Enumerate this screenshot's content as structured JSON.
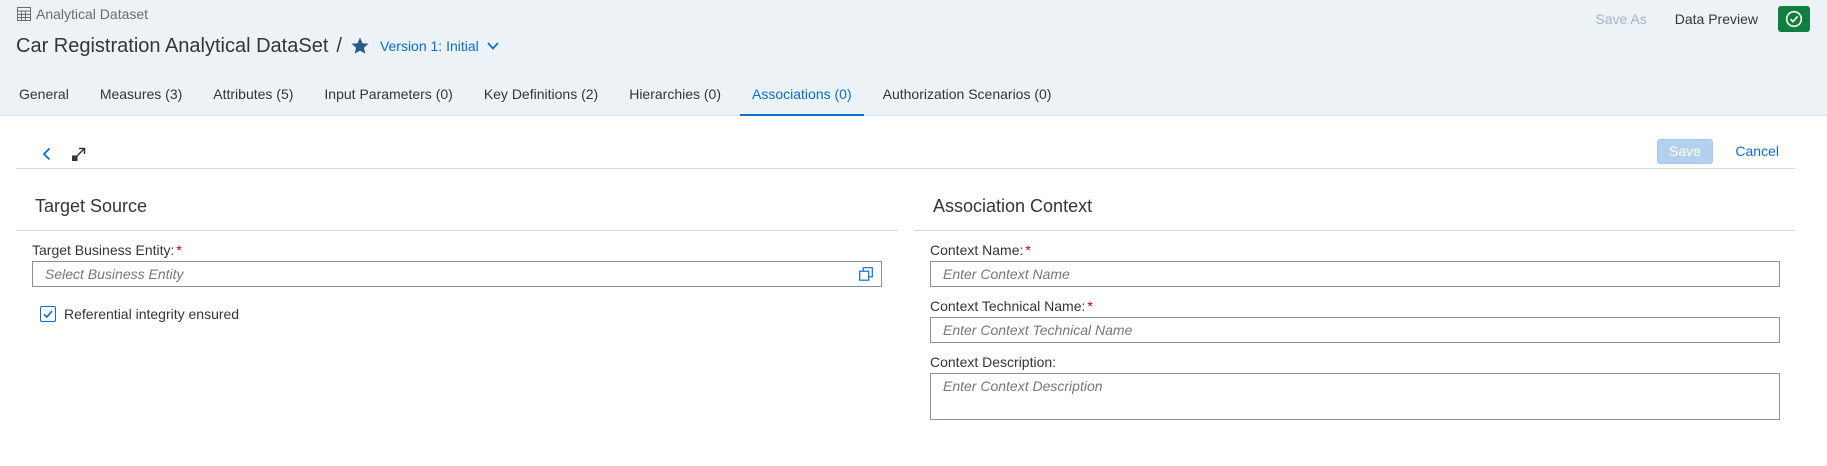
{
  "header": {
    "object_type": "Analytical Dataset",
    "object_type_icon": "table-icon",
    "title": "Car Registration Analytical DataSet",
    "separator": "/",
    "version_label": "Version 1: Initial",
    "actions": {
      "save_as": "Save As",
      "data_preview": "Data Preview",
      "check_icon": "check-circle-icon"
    }
  },
  "tabs": [
    {
      "label": "General",
      "active": false
    },
    {
      "label": "Measures (3)",
      "active": false
    },
    {
      "label": "Attributes (5)",
      "active": false
    },
    {
      "label": "Input Parameters (0)",
      "active": false
    },
    {
      "label": "Key Definitions (2)",
      "active": false
    },
    {
      "label": "Hierarchies (0)",
      "active": false
    },
    {
      "label": "Associations (0)",
      "active": true
    },
    {
      "label": "Authorization Scenarios (0)",
      "active": false
    }
  ],
  "toolbar": {
    "back_icon": "chevron-left-icon",
    "expand_icon": "resize-icon",
    "save_label": "Save",
    "cancel_label": "Cancel"
  },
  "target_source": {
    "title": "Target Source",
    "business_entity_label": "Target Business Entity:",
    "business_entity_placeholder": "Select Business Entity",
    "referential_label": "Referential integrity ensured",
    "referential_checked": true
  },
  "association_context": {
    "title": "Association Context",
    "context_name_label": "Context Name:",
    "context_name_placeholder": "Enter Context Name",
    "technical_name_label": "Context Technical Name:",
    "technical_name_placeholder": "Enter Context Technical Name",
    "description_label": "Context Description:",
    "description_placeholder": "Enter Context Description"
  },
  "required_marker": "*",
  "colors": {
    "accent": "#0a6ed1",
    "header_bg": "#edf2f6",
    "success": "#107e3e",
    "required": "#bb0000"
  }
}
